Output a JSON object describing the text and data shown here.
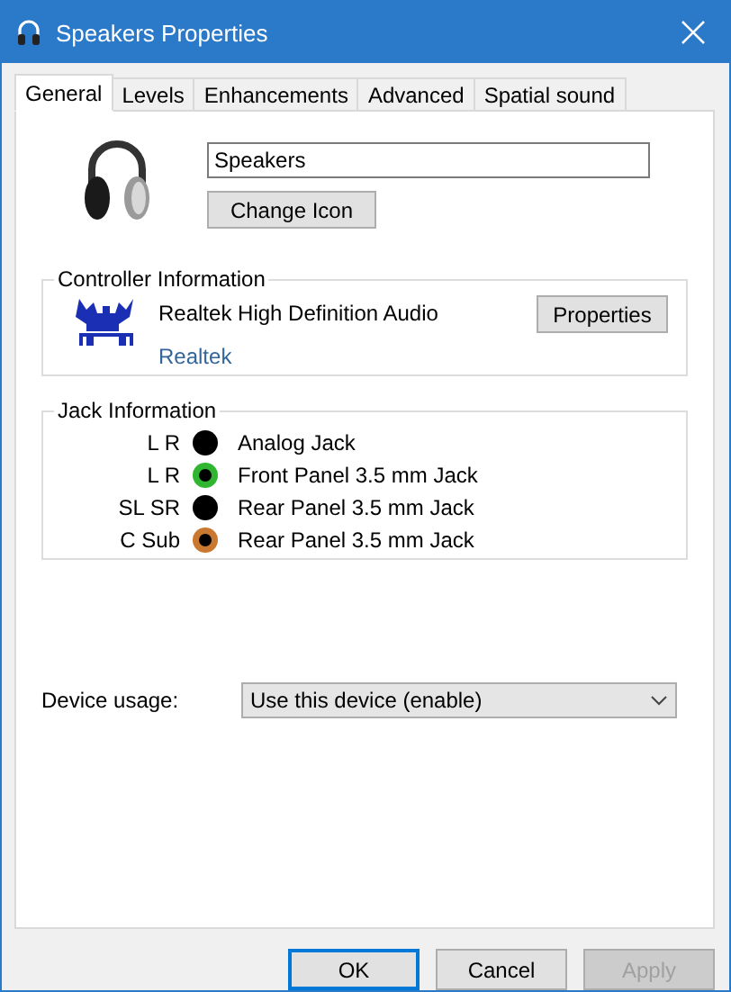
{
  "window": {
    "title": "Speakers Properties"
  },
  "tabs": [
    {
      "label": "General",
      "selected": true
    },
    {
      "label": "Levels",
      "selected": false
    },
    {
      "label": "Enhancements",
      "selected": false
    },
    {
      "label": "Advanced",
      "selected": false
    },
    {
      "label": "Spatial sound",
      "selected": false
    }
  ],
  "device": {
    "name": "Speakers",
    "change_icon_button": "Change Icon"
  },
  "controller": {
    "title": "Controller Information",
    "name": "Realtek High Definition Audio",
    "vendor_link": "Realtek",
    "properties_button": "Properties"
  },
  "jacks": {
    "title": "Jack Information",
    "items": [
      {
        "channels": "L R",
        "color": "#000000",
        "label": "Analog Jack"
      },
      {
        "channels": "L R",
        "color": "#2fb52f",
        "label": "Front Panel 3.5 mm Jack"
      },
      {
        "channels": "SL SR",
        "color": "#000000",
        "label": "Rear Panel 3.5 mm Jack"
      },
      {
        "channels": "C Sub",
        "color": "#c8782f",
        "label": "Rear Panel 3.5 mm Jack"
      }
    ]
  },
  "device_usage": {
    "label": "Device usage:",
    "value": "Use this device (enable)"
  },
  "buttons": [
    {
      "label": "OK",
      "default": true,
      "disabled": false
    },
    {
      "label": "Cancel",
      "default": false,
      "disabled": false
    },
    {
      "label": "Apply",
      "default": false,
      "disabled": true
    }
  ]
}
